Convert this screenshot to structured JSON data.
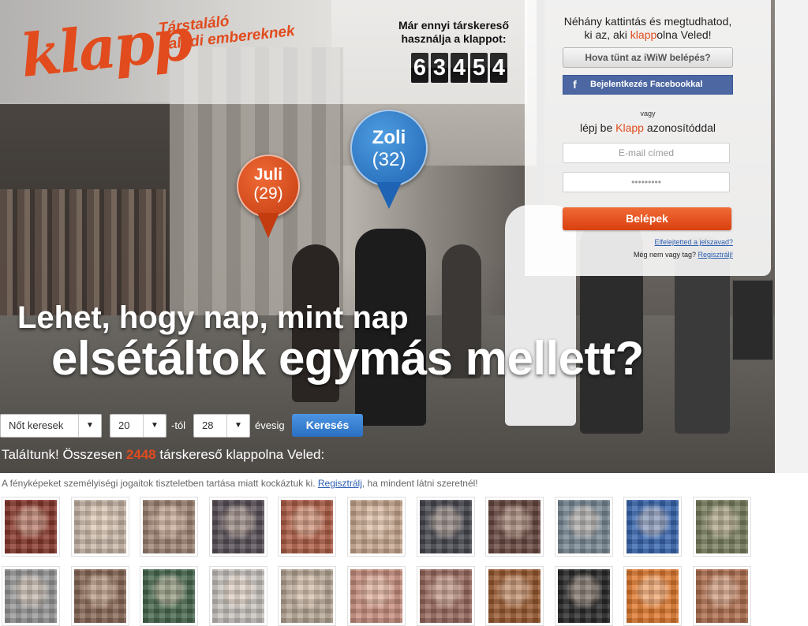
{
  "brand": {
    "logo_text": "klapp",
    "tagline_line1": "Társtaláló",
    "tagline_line2": "valódi embereknek",
    "accent_color": "#e14b1d"
  },
  "counter": {
    "title_line1": "Már ennyi társkereső",
    "title_line2": "használja a klappot:",
    "digits": [
      "6",
      "3",
      "4",
      "5",
      "4"
    ]
  },
  "login": {
    "intro_line1": "Néhány kattintás és megtudhatod,",
    "intro_line2_before": "ki az, aki ",
    "intro_line2_highlight": "klapp",
    "intro_line2_after": "olna Veled!",
    "iwiw_button": "Hova tűnt az iWiW belépés?",
    "facebook_icon": "f",
    "facebook_button": "Bejelentkezés Facebookkal",
    "or_text": "vagy",
    "login_with_before": "lépj be ",
    "login_with_highlight": "Klapp",
    "login_with_after": " azonosítóddal",
    "email_placeholder": "E-mail címed",
    "password_value": "•••••••••",
    "submit_button": "Belépek",
    "forgot_link": "Elfelejtetted a jelszavad?",
    "not_member_text": "Még nem vagy tag? ",
    "register_link": "Regisztrálj!"
  },
  "pins": {
    "juli": {
      "name": "Juli",
      "age": "(29)"
    },
    "zoli": {
      "name": "Zoli",
      "age": "(32)"
    }
  },
  "headline": {
    "line1": "Lehet, hogy nap, mint nap",
    "line2": "elsétáltok egymás mellett?"
  },
  "search": {
    "gender_value": "Nőt keresek",
    "age_from_value": "20",
    "from_suffix": "-tól",
    "age_to_value": "28",
    "to_suffix": "évesig",
    "submit": "Keresés",
    "caret_icon": "▼"
  },
  "results": {
    "text_before": "TaláItunk! Összesen ",
    "count": "2448",
    "text_after": " társkereső klappolna Veled:"
  },
  "privacy": {
    "text_before": "A fényképeket személyiségi jogaitok tiszteletben tartása miatt kockáztuk ki. ",
    "link": "Regisztrálj",
    "text_after": ", ha mindent látni szeretnél!"
  },
  "thumbnails": {
    "row1": [
      "#8a3a2e",
      "#c9b8a8",
      "#a08575",
      "#5a5158",
      "#b06048",
      "#c8a890",
      "#4a4a52",
      "#6a4a42",
      "#7a8a96",
      "#3a68b0",
      "#7a8060"
    ],
    "row2": [
      "#9a9a9a",
      "#8a6a58",
      "#4a6a50",
      "#c8c4c0",
      "#b8a898",
      "#c89080",
      "#9a6a60",
      "#9a5a30",
      "#2a2a2a",
      "#e07a30",
      "#b07050"
    ]
  }
}
